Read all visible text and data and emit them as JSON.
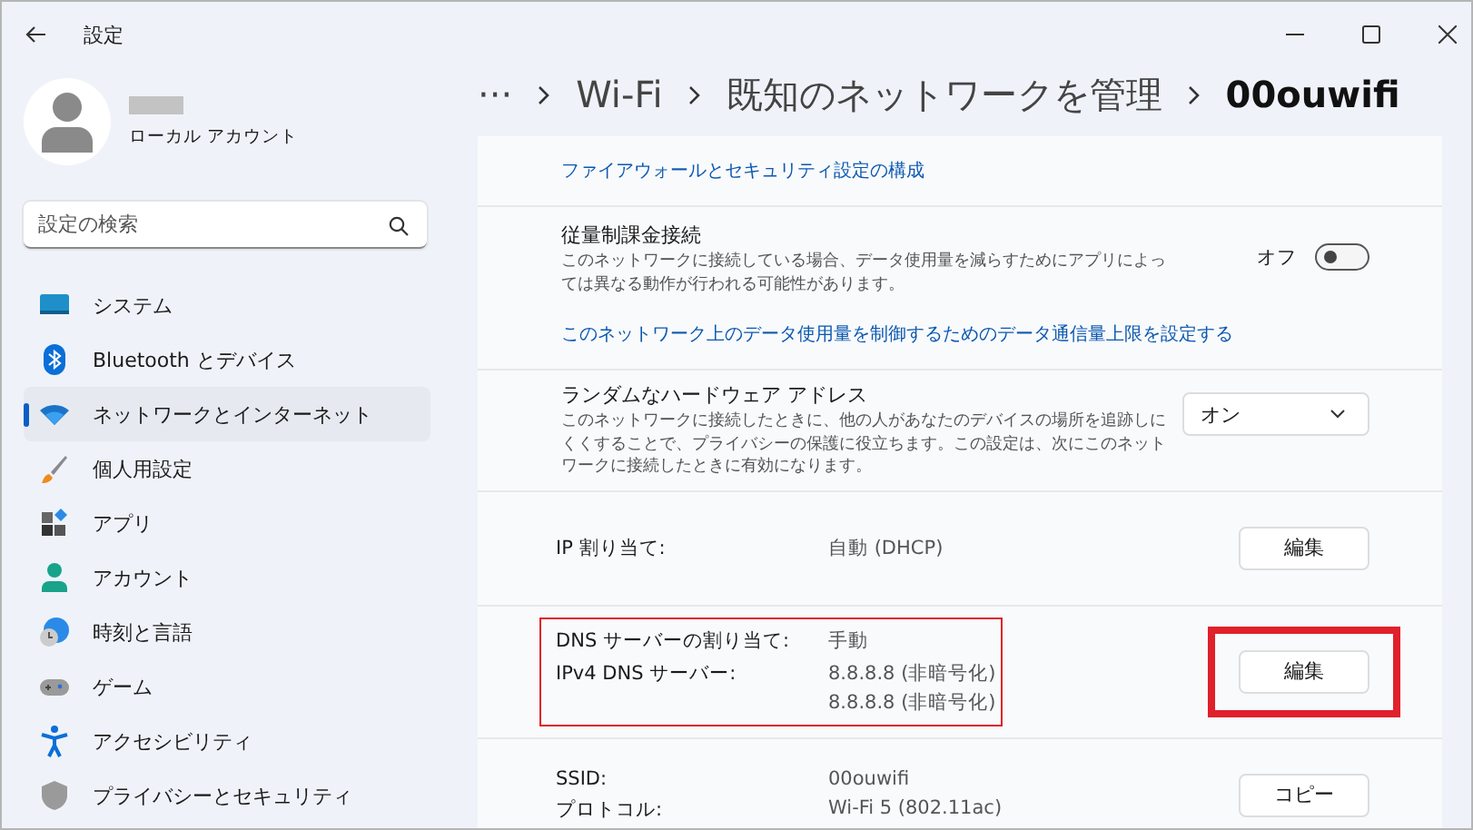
{
  "window": {
    "title": "設定"
  },
  "account": {
    "type": "ローカル アカウント"
  },
  "search": {
    "placeholder": "設定の検索"
  },
  "sidebar": {
    "items": [
      {
        "label": "システム",
        "selected": false
      },
      {
        "label": "Bluetooth とデバイス",
        "selected": false
      },
      {
        "label": "ネットワークとインターネット",
        "selected": true
      },
      {
        "label": "個人用設定",
        "selected": false
      },
      {
        "label": "アプリ",
        "selected": false
      },
      {
        "label": "アカウント",
        "selected": false
      },
      {
        "label": "時刻と言語",
        "selected": false
      },
      {
        "label": "ゲーム",
        "selected": false
      },
      {
        "label": "アクセシビリティ",
        "selected": false
      },
      {
        "label": "プライバシーとセキュリティ",
        "selected": false
      }
    ]
  },
  "breadcrumb": [
    "···",
    "Wi-Fi",
    "既知のネットワークを管理",
    "00ouwifi"
  ],
  "rows": [
    {
      "kind": "link",
      "link": "ファイアウォールとセキュリティ設定の構成"
    },
    {
      "kind": "toggle",
      "title": "従量制課金接続",
      "description": "このネットワークに接続している場合、データ使用量を減らすためにアプリによっては異なる動作が行われる可能性があります。",
      "state_label": "オフ",
      "on": false,
      "link": "このネットワーク上のデータ使用量を制御するためのデータ通信量上限を設定する"
    },
    {
      "kind": "dropdown",
      "title": "ランダムなハードウェア アドレス",
      "description": "このネットワークに接続したときに、他の人があなたのデバイスの場所を追跡しにくくすることで、プライバシーの保護に役立ちます。この設定は、次にこのネットワークに接続したときに有効になります。",
      "value": "オン"
    },
    {
      "kind": "props",
      "highlighted": false,
      "button": "編集",
      "button_highlighted": false,
      "props": [
        {
          "label": "IP 割り当て:",
          "values": [
            "自動 (DHCP)"
          ]
        }
      ]
    },
    {
      "kind": "props",
      "highlighted": true,
      "button": "編集",
      "button_highlighted": true,
      "props": [
        {
          "label": "DNS サーバーの割り当て:",
          "values": [
            "手動"
          ]
        },
        {
          "label": "IPv4 DNS サーバー:",
          "values": [
            "8.8.8.8 (非暗号化)",
            "8.8.8.8 (非暗号化)"
          ]
        }
      ]
    },
    {
      "kind": "props",
      "highlighted": false,
      "button": "コピー",
      "button_highlighted": false,
      "props": [
        {
          "label": "SSID:",
          "values": [
            "00ouwifi"
          ]
        },
        {
          "label": "プロトコル:",
          "values": [
            "Wi-Fi 5 (802.11ac)"
          ]
        }
      ]
    }
  ]
}
